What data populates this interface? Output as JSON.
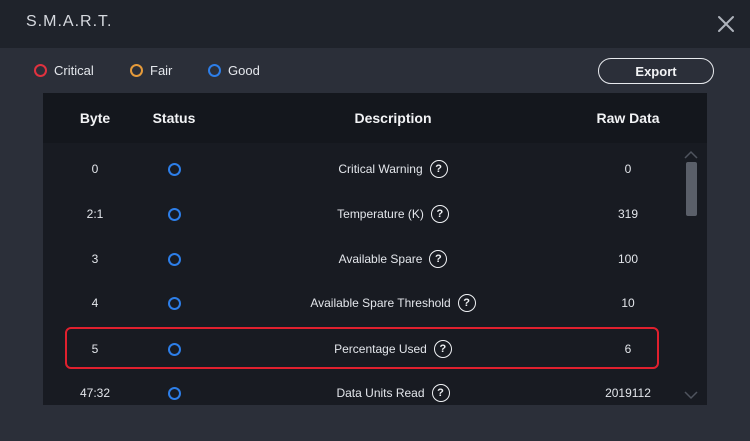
{
  "window": {
    "title": "S.M.A.R.T."
  },
  "legend": [
    {
      "label": "Critical",
      "color": "#e0323f"
    },
    {
      "label": "Fair",
      "color": "#e59a3a"
    },
    {
      "label": "Good",
      "color": "#2d7ee8"
    }
  ],
  "toolbar": {
    "export_label": "Export"
  },
  "table": {
    "columns": [
      "Byte",
      "Status",
      "Description",
      "Raw Data"
    ],
    "rows": [
      {
        "byte": "0",
        "status": "good",
        "description": "Critical Warning",
        "raw": "0"
      },
      {
        "byte": "2:1",
        "status": "good",
        "description": "Temperature (K)",
        "raw": "319"
      },
      {
        "byte": "3",
        "status": "good",
        "description": "Available Spare",
        "raw": "100"
      },
      {
        "byte": "4",
        "status": "good",
        "description": "Available Spare Threshold",
        "raw": "10"
      },
      {
        "byte": "5",
        "status": "good",
        "description": "Percentage Used",
        "raw": "6"
      },
      {
        "byte": "47:32",
        "status": "good",
        "description": "Data Units Read",
        "raw": "2019112"
      }
    ],
    "highlighted_row_index": 4
  },
  "icons": {
    "close": "close-icon",
    "help": "question-icon",
    "scroll_up": "chevron-up-icon",
    "scroll_down": "chevron-down-icon"
  },
  "help_glyph": "?"
}
